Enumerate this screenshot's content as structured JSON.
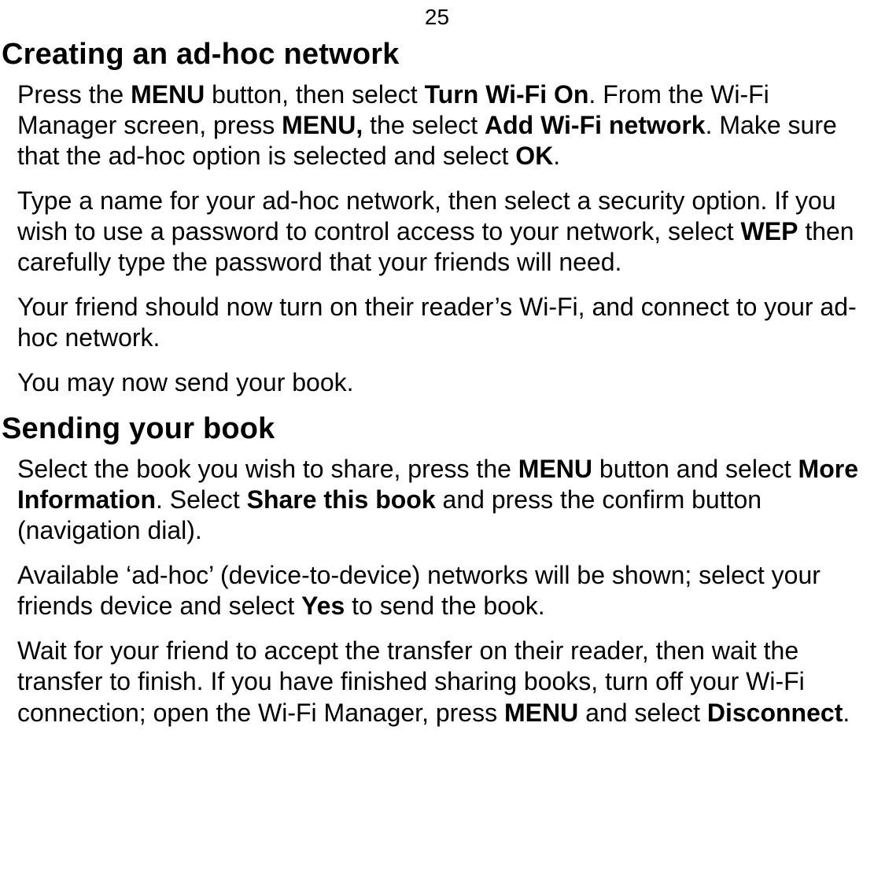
{
  "page_number": "25",
  "sections": [
    {
      "heading": "Creating an ad-hoc network",
      "paragraphs": [
        {
          "runs": [
            {
              "t": "Press the "
            },
            {
              "t": "MENU",
              "b": true
            },
            {
              "t": " button, then select "
            },
            {
              "t": "Turn Wi-Fi On",
              "b": true
            },
            {
              "t": ". From the Wi-Fi Manager screen, press "
            },
            {
              "t": "MENU,",
              "b": true
            },
            {
              "t": " the select "
            },
            {
              "t": "Add Wi-Fi network",
              "b": true
            },
            {
              "t": ". Make sure that the ad-hoc option is selected and select "
            },
            {
              "t": "OK",
              "b": true
            },
            {
              "t": "."
            }
          ]
        },
        {
          "runs": [
            {
              "t": "Type a name for your ad-hoc network, then select a security option. If you wish to use a password to control access to your network, select "
            },
            {
              "t": "WEP",
              "b": true
            },
            {
              "t": " then carefully type the password that your friends will need."
            }
          ]
        },
        {
          "runs": [
            {
              "t": "Your friend should now turn on their reader’s Wi-Fi, and connect to your ad-hoc network."
            }
          ]
        },
        {
          "runs": [
            {
              "t": "You may now send your book."
            }
          ]
        }
      ]
    },
    {
      "heading": "Sending your book",
      "paragraphs": [
        {
          "runs": [
            {
              "t": "Select the book you wish to share, press the "
            },
            {
              "t": "MENU",
              "b": true
            },
            {
              "t": " button and select "
            },
            {
              "t": "More Information",
              "b": true
            },
            {
              "t": ". Select "
            },
            {
              "t": "Share this book",
              "b": true
            },
            {
              "t": " and press the confirm button (navigation dial)."
            }
          ]
        },
        {
          "runs": [
            {
              "t": "Available ‘ad-hoc’ (device-to-device) networks will be shown; select your friends device and select "
            },
            {
              "t": "Yes",
              "b": true
            },
            {
              "t": " to send the book."
            }
          ]
        },
        {
          "runs": [
            {
              "t": "Wait for your friend to accept the transfer on their reader, then wait the transfer to finish. If you have finished sharing books, turn off your Wi-Fi connection; open the Wi-Fi Manager, press "
            },
            {
              "t": "MENU",
              "b": true
            },
            {
              "t": " and select "
            },
            {
              "t": "Disconnect",
              "b": true
            },
            {
              "t": "."
            }
          ]
        }
      ]
    }
  ]
}
